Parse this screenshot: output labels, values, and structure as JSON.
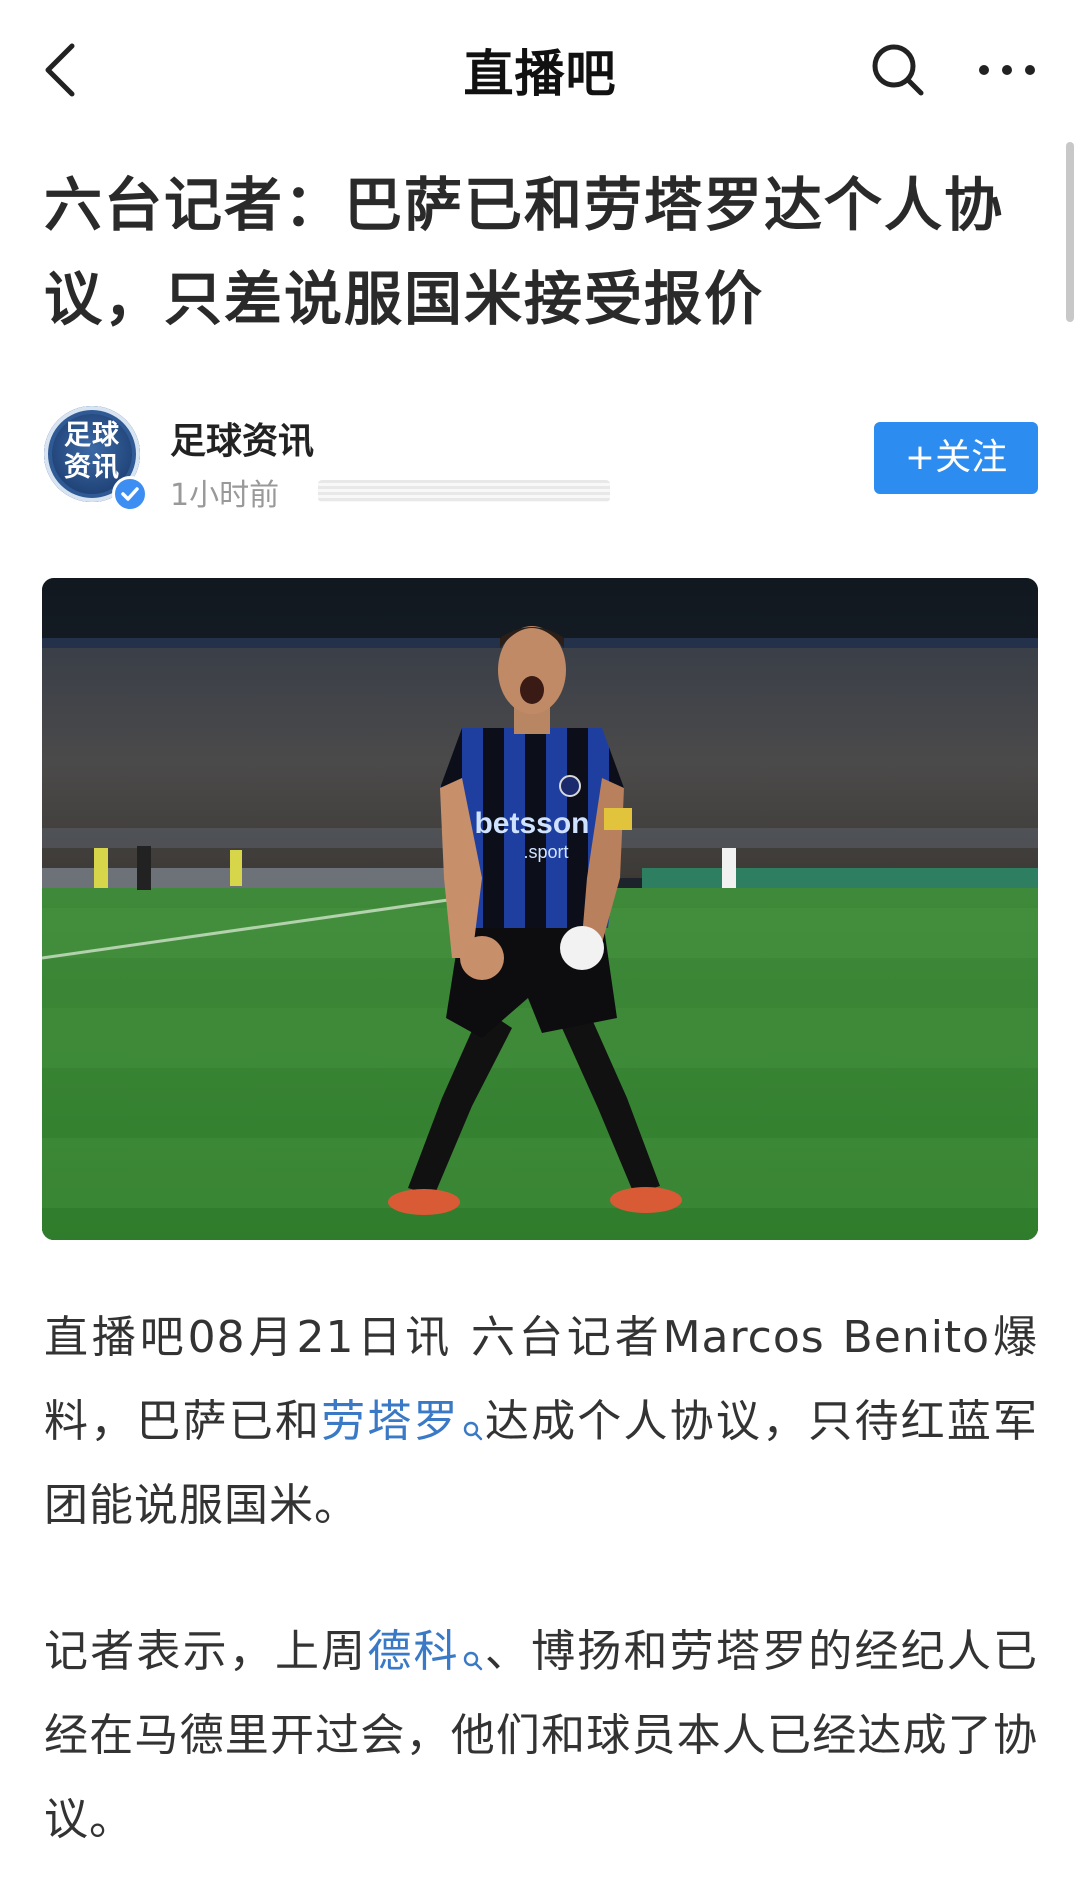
{
  "nav": {
    "title": "直播吧",
    "back_icon": "chevron-left-icon",
    "search_icon": "search-icon",
    "more_icon": "more-dots-icon"
  },
  "article": {
    "headline": "六台记者：巴萨已和劳塔罗达个人协议，只差说服国米接受报价",
    "author": {
      "avatar_text_line1": "足球",
      "avatar_text_line2": "资讯",
      "name": "足球资讯",
      "time": "1小时前",
      "follow_label": "+关注"
    },
    "photo": {
      "jersey_sponsor_line1": "betsson",
      "jersey_sponsor_line2": ".sport"
    },
    "paragraphs": [
      {
        "text_before": "直播吧08月21日讯  六台记者Marcos  Benito爆料，巴萨已和",
        "link": "劳塔罗",
        "text_after": "达成个人协议，只待红蓝军团能说服国米。"
      },
      {
        "text_before": "记者表示，上周",
        "link": "德科",
        "text_after": "、博扬和劳塔罗的经纪人已经在马德里开过会，他们和球员本人已经达成了协议。"
      }
    ]
  },
  "colors": {
    "accent": "#2d8cf0",
    "link": "#3a79c6",
    "muted_text": "#999999"
  }
}
